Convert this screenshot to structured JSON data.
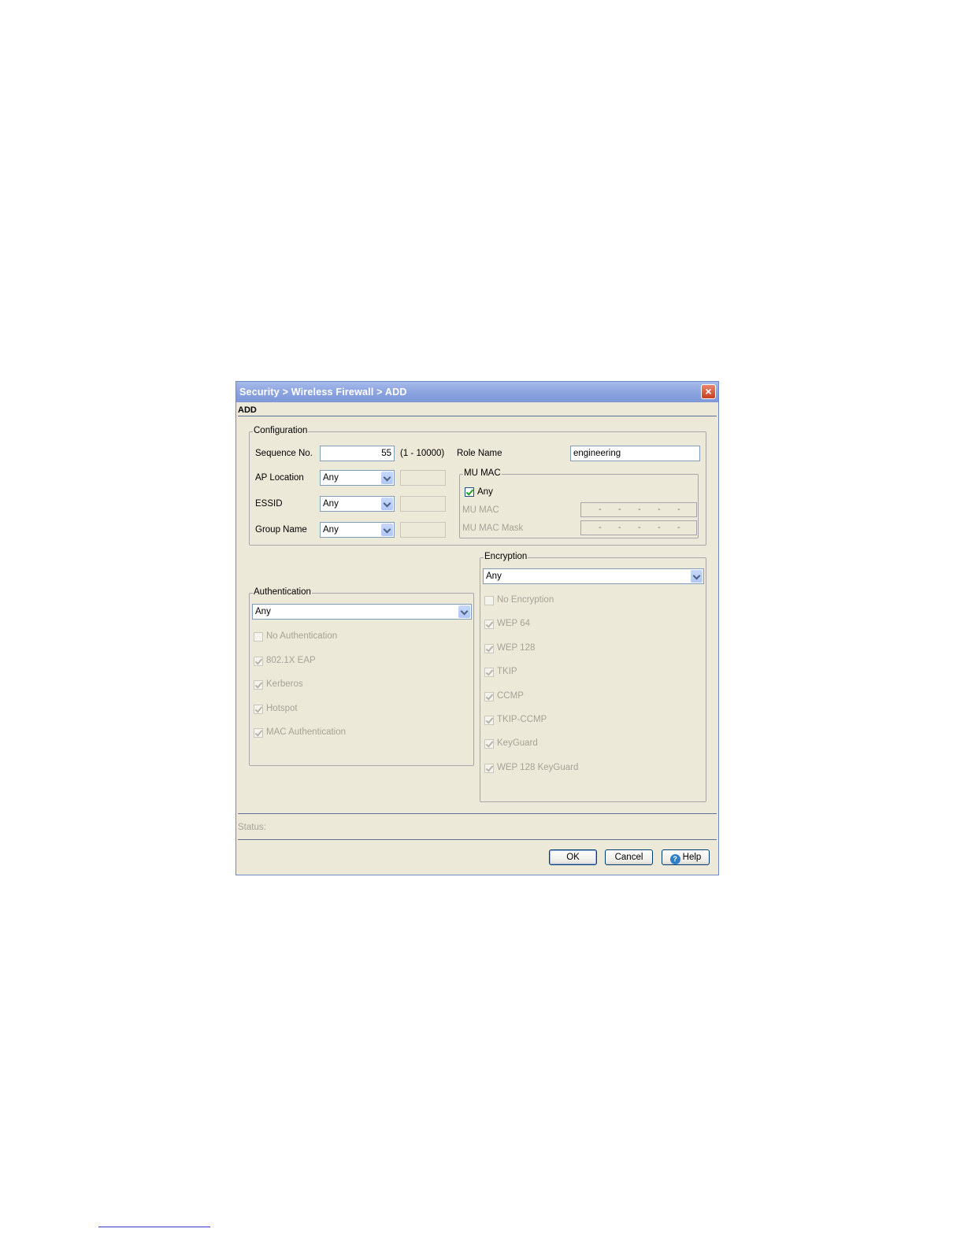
{
  "window": {
    "title": "Security > Wireless Firewall > ADD",
    "subheader": "ADD"
  },
  "configuration": {
    "legend": "Configuration",
    "sequence_label": "Sequence No.",
    "sequence_value": "55",
    "sequence_range": "(1 - 10000)",
    "role_name_label": "Role Name",
    "role_name_value": "engineering",
    "ap_location_label": "AP Location",
    "ap_location_value": "Any",
    "essid_label": "ESSID",
    "essid_value": "Any",
    "group_name_label": "Group Name",
    "group_name_value": "Any"
  },
  "mu_mac": {
    "legend": "MU MAC",
    "any_label": "Any",
    "any_checked": true,
    "mac_label": "MU MAC",
    "mask_label": "MU MAC Mask"
  },
  "authentication": {
    "legend": "Authentication",
    "selected": "Any",
    "options": [
      {
        "label": "No Authentication",
        "checked": false
      },
      {
        "label": "802.1X EAP",
        "checked": true
      },
      {
        "label": "Kerberos",
        "checked": true
      },
      {
        "label": "Hotspot",
        "checked": true
      },
      {
        "label": "MAC Authentication",
        "checked": true
      }
    ]
  },
  "encryption": {
    "legend": "Encryption",
    "selected": "Any",
    "options": [
      {
        "label": "No Encryption",
        "checked": false
      },
      {
        "label": "WEP 64",
        "checked": true
      },
      {
        "label": "WEP 128",
        "checked": true
      },
      {
        "label": "TKIP",
        "checked": true
      },
      {
        "label": "CCMP",
        "checked": true
      },
      {
        "label": "TKIP-CCMP",
        "checked": true
      },
      {
        "label": "KeyGuard",
        "checked": true
      },
      {
        "label": "WEP 128 KeyGuard",
        "checked": true
      }
    ]
  },
  "status": {
    "label": "Status:"
  },
  "buttons": {
    "ok": "OK",
    "cancel": "Cancel",
    "help": "Help"
  },
  "icons": {
    "close": "close-icon",
    "help": "help-icon",
    "dropdown": "chevron-down-icon",
    "checkbox": "checkbox"
  }
}
